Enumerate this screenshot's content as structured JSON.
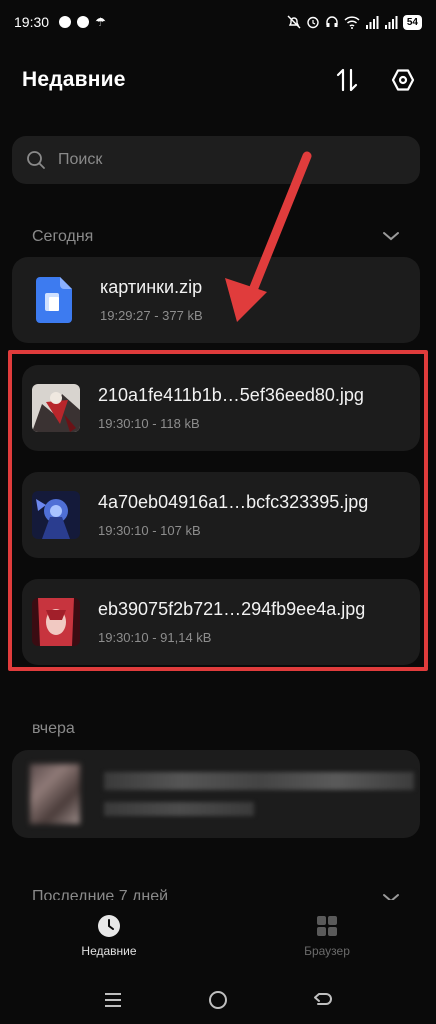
{
  "status_bar": {
    "time": "19:30",
    "battery": "54"
  },
  "header": {
    "title": "Недавние"
  },
  "search": {
    "placeholder": "Поиск"
  },
  "sections": {
    "today": "Сегодня",
    "yesterday": "вчера",
    "last7": "Последние 7 дней"
  },
  "files_today": [
    {
      "name": "картинки.zip",
      "meta": "19:29:27 - 377 kB",
      "icon": "zip-archive-icon"
    },
    {
      "name": "210a1fe411b1b…5ef36eed80.jpg",
      "meta": "19:30:10 - 118 kB",
      "icon": "image-thumbnail"
    },
    {
      "name": "4a70eb04916a1…bcfc323395.jpg",
      "meta": "19:30:10 - 107 kB",
      "icon": "image-thumbnail"
    },
    {
      "name": "eb39075f2b721…294fb9ee4a.jpg",
      "meta": "19:30:10 - 91,14 kB",
      "icon": "image-thumbnail"
    }
  ],
  "bottom_nav": {
    "recent": "Недавние",
    "browser": "Браузер"
  },
  "colors": {
    "accent_red": "#e03c3c",
    "card_bg": "#1c1c1c",
    "zip_blue": "#3d7bf0"
  }
}
